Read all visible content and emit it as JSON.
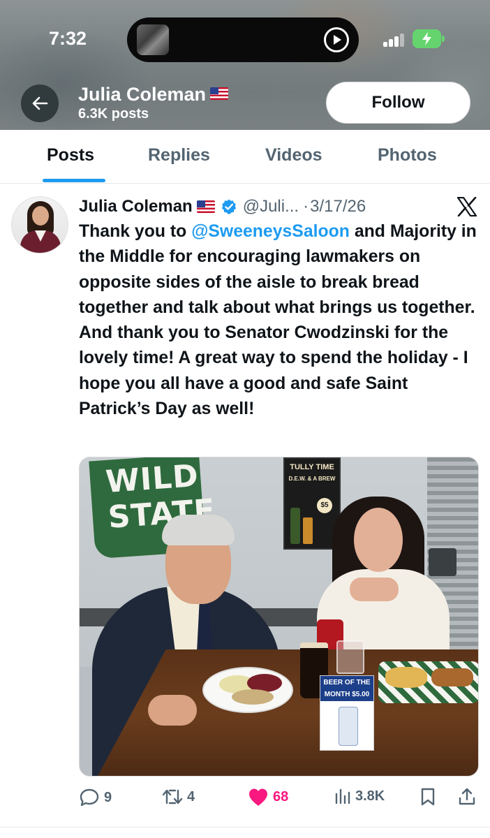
{
  "status_bar": {
    "time": "7:32",
    "battery_color": "#65d46e"
  },
  "header": {
    "back_icon": "arrow-left-icon",
    "name": "Julia Coleman",
    "name_flag_icon": "us-flag-icon",
    "posts_count": "6.3K posts",
    "follow_label": "Follow"
  },
  "tabs": [
    {
      "label": "Posts",
      "active": true
    },
    {
      "label": "Replies",
      "active": false
    },
    {
      "label": "Videos",
      "active": false
    },
    {
      "label": "Photos",
      "active": false
    }
  ],
  "tweet": {
    "author_name": "Julia Coleman",
    "verified": true,
    "handle": "@Juli...",
    "separator": "·",
    "date": "3/17/26",
    "text_before_mention": "Thank you to ",
    "mention": "@SweeneysSaloon",
    "text_after_mention": " and Majority in the Middle for encouraging lawmakers on opposite sides of the aisle to break bread together and talk about what brings us together. And thank you to Senator Cwodzinski for the lovely time! A great way to spend the holiday - I hope you all have a good and safe Saint Patrick’s Day as well!",
    "photo": {
      "sign_text": "WILD STATE",
      "poster_title": "TULLY TIME",
      "poster_subtitle": "D.E.W. & A BREW",
      "poster_price": "$5",
      "promo_text": "BEER OF THE MONTH $5.00 PINTS"
    }
  },
  "actions": {
    "replies": "9",
    "reposts": "4",
    "likes": "68",
    "views": "3.8K",
    "like_color": "#f91880",
    "accent_color": "#1d9bf0"
  }
}
